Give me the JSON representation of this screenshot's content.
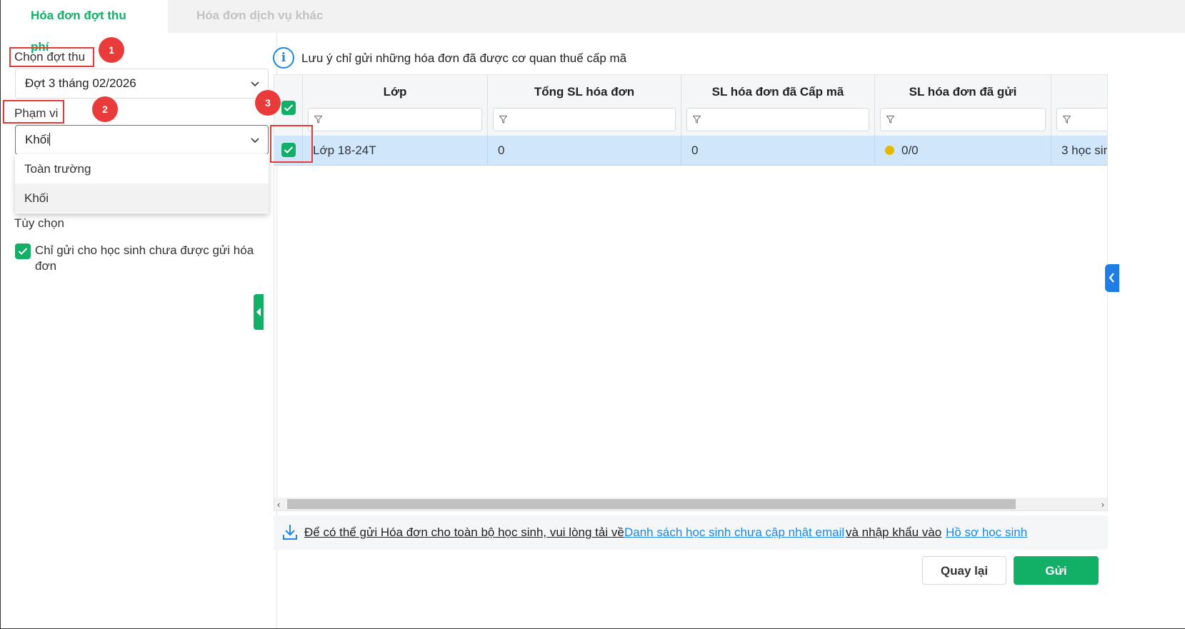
{
  "tabs": [
    {
      "label": "Hóa đơn đợt thu phí",
      "active": true
    },
    {
      "label": "Hóa đơn dịch vụ khác",
      "active": false
    }
  ],
  "left_panel": {
    "period_label": "Chọn đợt thu",
    "period_value": "Đợt 3 tháng 02/2026",
    "scope_label": "Phạm vi",
    "scope_value": "Khối",
    "scope_options": [
      "Toàn trường",
      "Khối"
    ],
    "options_label": "Tùy chọn",
    "only_unsent_label": "Chỉ gửi cho học sinh chưa được gửi hóa đơn",
    "only_unsent_checked": true
  },
  "annotations": {
    "step1": "1",
    "step2": "2",
    "step3": "3"
  },
  "info_note": "Lưu ý chỉ gửi những hóa đơn đã được cơ quan thuế cấp mã",
  "table": {
    "columns": [
      "Lớp",
      "Tổng SL hóa đơn",
      "SL hóa đơn đã Cấp mã",
      "SL hóa đơn đã gửi"
    ],
    "rows": [
      {
        "checked": true,
        "class": "Lớp 18-24T",
        "total": "0",
        "issued": "0",
        "sent": "0/0",
        "extra": "3 học sin"
      }
    ]
  },
  "notice": {
    "text1": "Để có thể gửi Hóa đơn cho toàn bộ học sinh, vui lòng tải về",
    "link1": "Danh sách học sinh chưa cập nhật email",
    "text2": "và nhập khẩu vào",
    "link2": "Hồ sơ học sinh"
  },
  "buttons": {
    "back": "Quay lại",
    "send": "Gửi"
  },
  "colors": {
    "accent": "#12b067",
    "link": "#1e88e5",
    "selected_row": "#cfe6fb",
    "annotation": "#ea3b3b"
  }
}
